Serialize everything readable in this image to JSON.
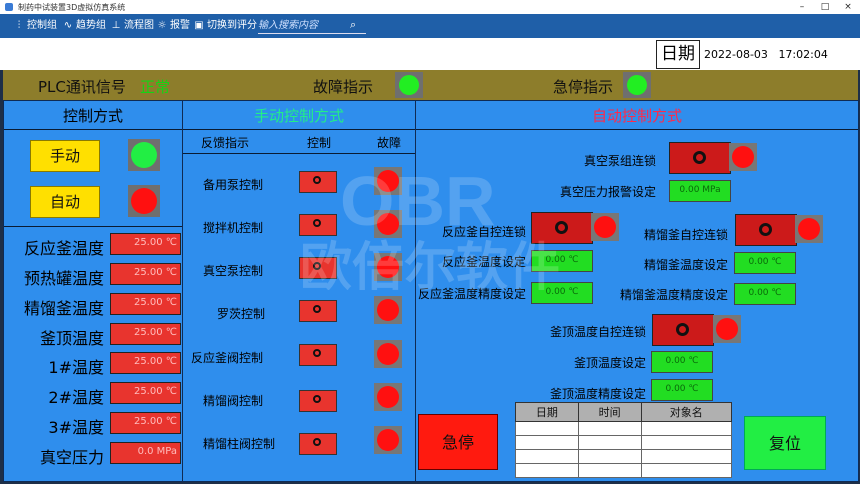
{
  "window": {
    "title": "制药中试装置3D虚拟仿真系统",
    "controls": [
      "–",
      "□",
      "×"
    ]
  },
  "toolbar": {
    "items": [
      {
        "label": "控制组",
        "icon": "sliders-icon",
        "glyph": "⫶"
      },
      {
        "label": "趋势组",
        "icon": "trend-icon",
        "glyph": "∿"
      },
      {
        "label": "流程图",
        "icon": "flowchart-icon",
        "glyph": "⊥"
      },
      {
        "label": "报警",
        "icon": "alarm-icon",
        "glyph": "☼"
      },
      {
        "label": "切换到评分",
        "icon": "switch-icon",
        "glyph": "▣"
      }
    ],
    "search_placeholder": "输入搜索内容",
    "search_glyph": "⌕"
  },
  "header": {
    "date_label": "日期",
    "date": "2022-08-03",
    "time": "17:02:04"
  },
  "status": {
    "plc_label": "PLC通讯信号",
    "plc_value": "正常",
    "fault_label": "故障指示",
    "estop_label": "急停指示",
    "colors": {
      "ok": "#22ee22",
      "plc_value": "#14d414"
    }
  },
  "control_mode": {
    "title": "控制方式",
    "manual": "手动",
    "auto": "自动",
    "manual_led": "#22ee44",
    "auto_led": "#ff1010"
  },
  "readings": [
    {
      "label": "反应釜温度",
      "value": "25.00 ℃"
    },
    {
      "label": "预热罐温度",
      "value": "25.00 ℃"
    },
    {
      "label": "精馏釜温度",
      "value": "25.00 ℃"
    },
    {
      "label": "釜顶温度",
      "value": "25.00 ℃"
    },
    {
      "label": "1#温度",
      "value": "25.00 ℃"
    },
    {
      "label": "2#温度",
      "value": "25.00 ℃"
    },
    {
      "label": "3#温度",
      "value": "25.00 ℃"
    },
    {
      "label": "真空压力",
      "value": "0.0 MPa"
    }
  ],
  "manual_mode": {
    "title": "手动控制方式",
    "col_feedback": "反馈指示",
    "col_control": "控制",
    "col_fault": "故障",
    "rows": [
      "备用泵控制",
      "搅拌机控制",
      "真空泵控制",
      "罗茨控制",
      "反应釜阀控制",
      "精馏阀控制",
      "精馏柱阀控制"
    ]
  },
  "auto_mode": {
    "title": "自动控制方式",
    "vacuum_interlock": "真空泵组连锁",
    "vacuum_alarm": "真空压力报警设定",
    "vacuum_alarm_value": "0.00 MPa",
    "reactor_interlock": "反应釜自控连锁",
    "reactor_temp_set": "反应釜温度设定",
    "reactor_temp_value": "0.00 ℃",
    "reactor_precision": "反应釜温度精度设定",
    "reactor_precision_value": "0.00 ℃",
    "rectifier_interlock": "精馏釜自控连锁",
    "rectifier_temp_set": "精馏釜温度设定",
    "rectifier_temp_value": "0.00 ℃",
    "rectifier_precision": "精馏釜温度精度设定",
    "rectifier_precision_value": "0.00 ℃",
    "top_interlock": "釜顶温度自控连锁",
    "top_temp_set": "釜顶温度设定",
    "top_temp_value": "0.00 ℃",
    "top_precision": "釜顶温度精度设定",
    "top_precision_value": "0.00 ℃"
  },
  "actions": {
    "estop": "急停",
    "reset": "复位"
  },
  "log_table": {
    "headers": [
      "日期",
      "时间",
      "对象名"
    ],
    "empty_rows": 4
  },
  "watermark": {
    "brand": "OBR",
    "text": "欧倍尔软件"
  },
  "colors": {
    "panel": "#2f8eed",
    "status_bar": "#8d7d2b",
    "manual_title": "#22ee88",
    "auto_title": "#ff2a4a"
  }
}
